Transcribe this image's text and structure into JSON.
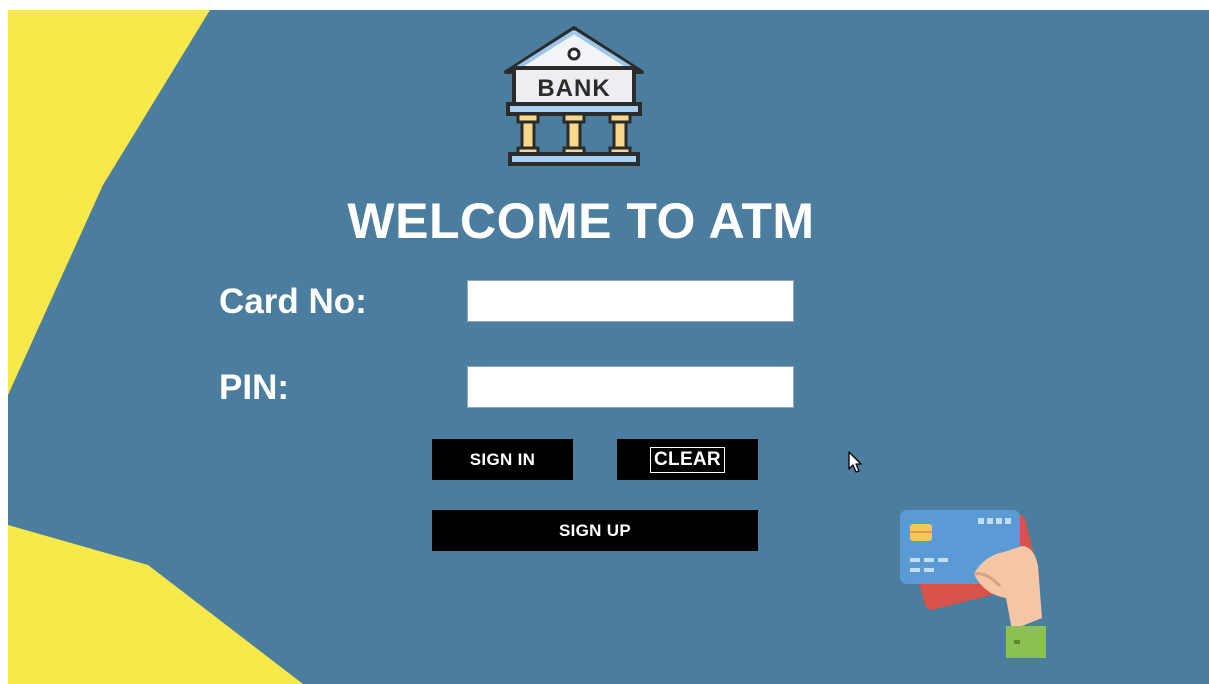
{
  "app": {
    "logo_text": "BANK",
    "title": "WELCOME TO ATM"
  },
  "form": {
    "card_label": "Card No:",
    "card_value": "",
    "pin_label": "PIN:",
    "pin_value": ""
  },
  "buttons": {
    "sign_in": "SIGN IN",
    "clear": "CLEAR",
    "sign_up": "SIGN UP"
  },
  "icons": {
    "logo": "bank-building-icon",
    "card": "hand-holding-credit-card-icon",
    "cursor": "mouse-pointer-icon"
  },
  "colors": {
    "background": "#4a7d9e",
    "accent": "#f7e94a",
    "button": "#000000"
  }
}
